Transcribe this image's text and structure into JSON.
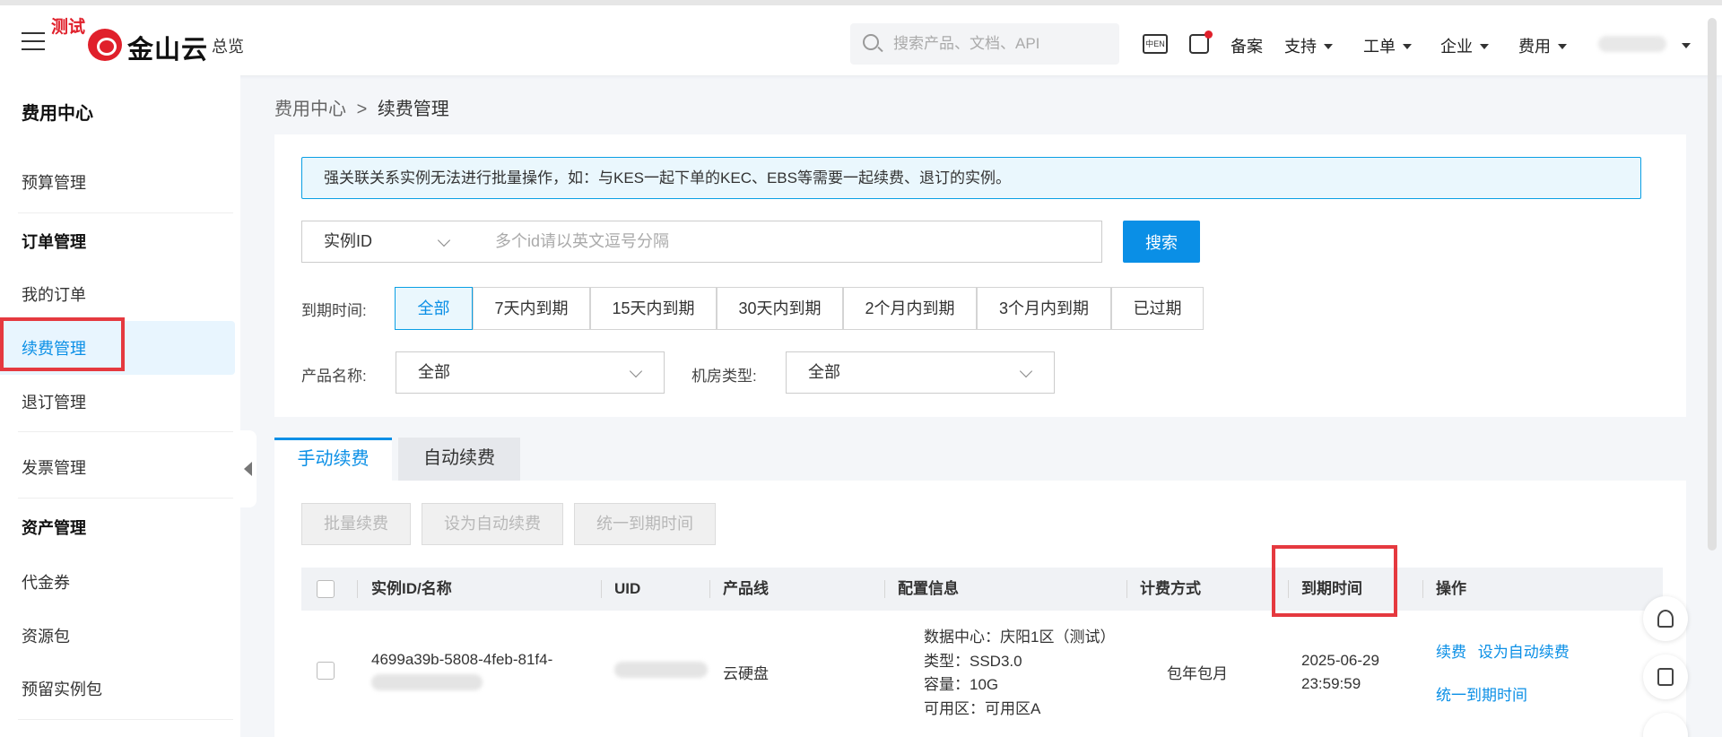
{
  "header": {
    "test_tag": "测试",
    "logo_text": "金山云",
    "overview": "总览",
    "search_placeholder": "搜索产品、文档、API",
    "lang_icon_text": "中EN",
    "nav": [
      {
        "label": "备案",
        "has_caret": false
      },
      {
        "label": "支持",
        "has_caret": true
      },
      {
        "label": "工单",
        "has_caret": true
      },
      {
        "label": "企业",
        "has_caret": true
      },
      {
        "label": "费用",
        "has_caret": true
      }
    ]
  },
  "sidebar": {
    "title": "费用中心",
    "items": {
      "budget": "预算管理",
      "order_group": "订单管理",
      "my_orders": "我的订单",
      "renewal": "续费管理",
      "unsubscribe": "退订管理",
      "invoice": "发票管理",
      "asset_group": "资产管理",
      "voucher": "代金券",
      "resource_pack": "资源包",
      "reserved_instance": "预留实例包"
    },
    "active": "续费管理"
  },
  "breadcrumb": {
    "parent": "费用中心",
    "separator": ">",
    "current": "续费管理"
  },
  "notice": "强关联关系实例无法进行批量操作，如：与KES一起下单的KEC、EBS等需要一起续费、退订的实例。",
  "filter": {
    "id_type": "实例ID",
    "id_placeholder": "多个id请以英文逗号分隔",
    "search_button": "搜索",
    "expire_label": "到期时间:",
    "expire_options": [
      "全部",
      "7天内到期",
      "15天内到期",
      "30天内到期",
      "2个月内到期",
      "3个月内到期",
      "已过期"
    ],
    "expire_selected": "全部",
    "product_label": "产品名称:",
    "product_value": "全部",
    "room_label": "机房类型:",
    "room_value": "全部"
  },
  "tabs": {
    "manual": "手动续费",
    "auto": "自动续费",
    "active": "手动续费"
  },
  "actions": {
    "batch_renew": "批量续费",
    "set_auto": "设为自动续费",
    "unify_expire": "统一到期时间"
  },
  "table": {
    "columns": [
      "实例ID/名称",
      "UID",
      "产品线",
      "配置信息",
      "计费方式",
      "到期时间",
      "操作"
    ],
    "rows": [
      {
        "instance_id": "4699a39b-5808-4feb-81f4-",
        "product": "云硬盘",
        "config": [
          "数据中心：庆阳1区（测试）",
          "类型：SSD3.0",
          "容量：10G",
          "可用区：可用区A"
        ],
        "billing": "包年包月",
        "expire_date": "2025-06-29",
        "expire_time": "23:59:59",
        "op_renew": "续费",
        "op_set_auto": "设为自动续费",
        "op_unify": "统一到期时间"
      }
    ]
  },
  "colors": {
    "accent": "#0a8fe6",
    "highlight_box": "#e5393f",
    "brand_red": "#e0202b"
  }
}
